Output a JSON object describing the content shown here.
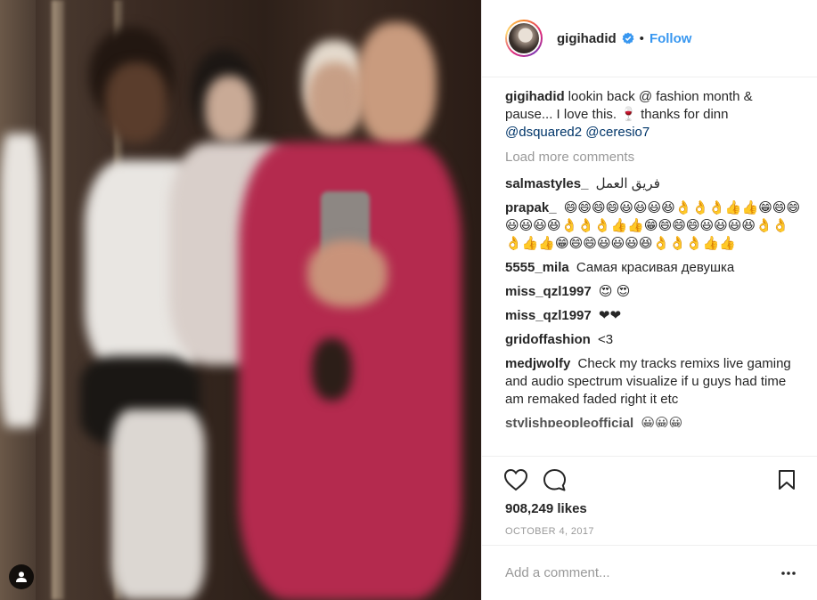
{
  "post": {
    "username": "gigihadid",
    "follow_label": "Follow",
    "separator": "•",
    "photo_alt": "Elevator selfie photo"
  },
  "caption": {
    "user": "gigihadid",
    "text": "lookin back @ fashion month & pause... I love this. 🍷 thanks for dinn",
    "mentions": "@dsquared2 @ceresio7"
  },
  "load_more_label": "Load more comments",
  "comments": [
    {
      "user": "salmastyles_",
      "text": "فريق العمل"
    },
    {
      "user": "prapak_",
      "text": "😄😄😄😄😃😃😃😆👌👌👌👍👍😁😄😄😃😃😃😆👌👌👌👍👍😁😄😄😄😃😃😃😆👌👌👌👍👍😁😄😄😃😃😃😆👌👌👌👍👍"
    },
    {
      "user": "5555_mila",
      "text": "Самая красивая девушка"
    },
    {
      "user": "miss_qzl1997",
      "text": "😍 😍"
    },
    {
      "user": "miss_qzl1997",
      "text": "❤❤"
    },
    {
      "user": "gridoffashion",
      "text": "<3"
    },
    {
      "user": "medjwolfy",
      "text": "Check my tracks remixs live gaming and audio spectrum visualize if u guys had time am remaked faded right it etc"
    },
    {
      "user": "stylishpeopleofficial",
      "text": "😀😀😀"
    }
  ],
  "likes": "908,249 likes",
  "date": "OCTOBER 4, 2017",
  "add_comment_placeholder": "Add a comment...",
  "icons": {
    "verified": "verified-badge-icon",
    "heart": "heart-icon",
    "comment": "comment-bubble-icon",
    "bookmark": "bookmark-icon",
    "more": "more-dots-icon",
    "tag": "user-tag-icon"
  },
  "colors": {
    "link": "#3897f0",
    "mention": "#003569",
    "muted": "#999999"
  }
}
